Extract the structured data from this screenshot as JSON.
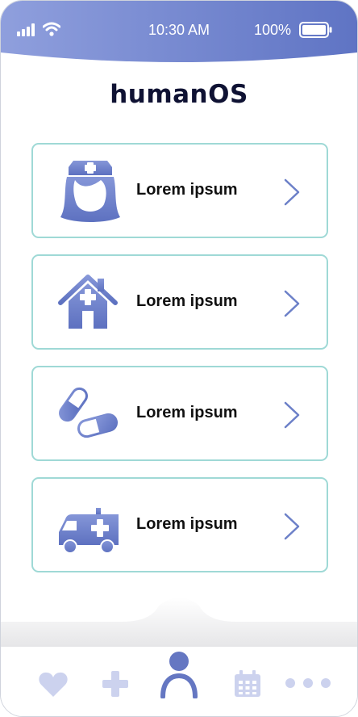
{
  "status_bar": {
    "time": "10:30 AM",
    "battery_text": "100%",
    "icons": [
      "signal-icon",
      "wifi-icon",
      "battery-icon"
    ],
    "gradient": [
      "#8f9fdd",
      "#5f74c4"
    ]
  },
  "app": {
    "title": "humanOS"
  },
  "menu": {
    "items": [
      {
        "label": "Lorem ipsum",
        "icon": "nurse-icon"
      },
      {
        "label": "Lorem ipsum",
        "icon": "hospital-icon"
      },
      {
        "label": "Lorem ipsum",
        "icon": "pills-icon"
      },
      {
        "label": "Lorem ipsum",
        "icon": "ambulance-icon"
      }
    ],
    "chevron": "chevron-right-icon",
    "border_color": "#9fd9d6",
    "icon_color": "#6c80c8"
  },
  "tab_bar": {
    "items": [
      "heart-icon",
      "plus-icon",
      "profile-icon",
      "calendar-icon",
      "more-icon"
    ],
    "active": "profile-icon",
    "inactive_color": "#ccd2ee",
    "active_color": "#6577c2"
  }
}
